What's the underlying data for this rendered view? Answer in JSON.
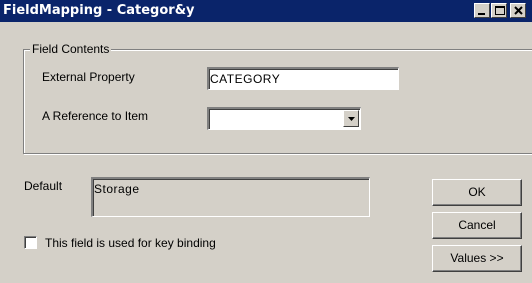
{
  "window": {
    "title": "FieldMapping - Categor&y"
  },
  "field_contents": {
    "legend": "Field Contents",
    "external_property_label": "External Property",
    "external_property_value": "CATEGORY",
    "reference_label": "A Reference to Item",
    "reference_value": ""
  },
  "default": {
    "label": "Default",
    "value": "Storage"
  },
  "key_binding": {
    "label": "This field is used for key binding",
    "checked": false
  },
  "buttons": {
    "ok": "OK",
    "cancel": "Cancel",
    "values": "Values >>"
  },
  "icons": {
    "minimize": "minimize-icon",
    "maximize": "maximize-icon",
    "close": "close-icon",
    "dropdown": "chevron-down-icon"
  },
  "colors": {
    "titlebar": "#0a246a",
    "face": "#d4d0c8"
  }
}
